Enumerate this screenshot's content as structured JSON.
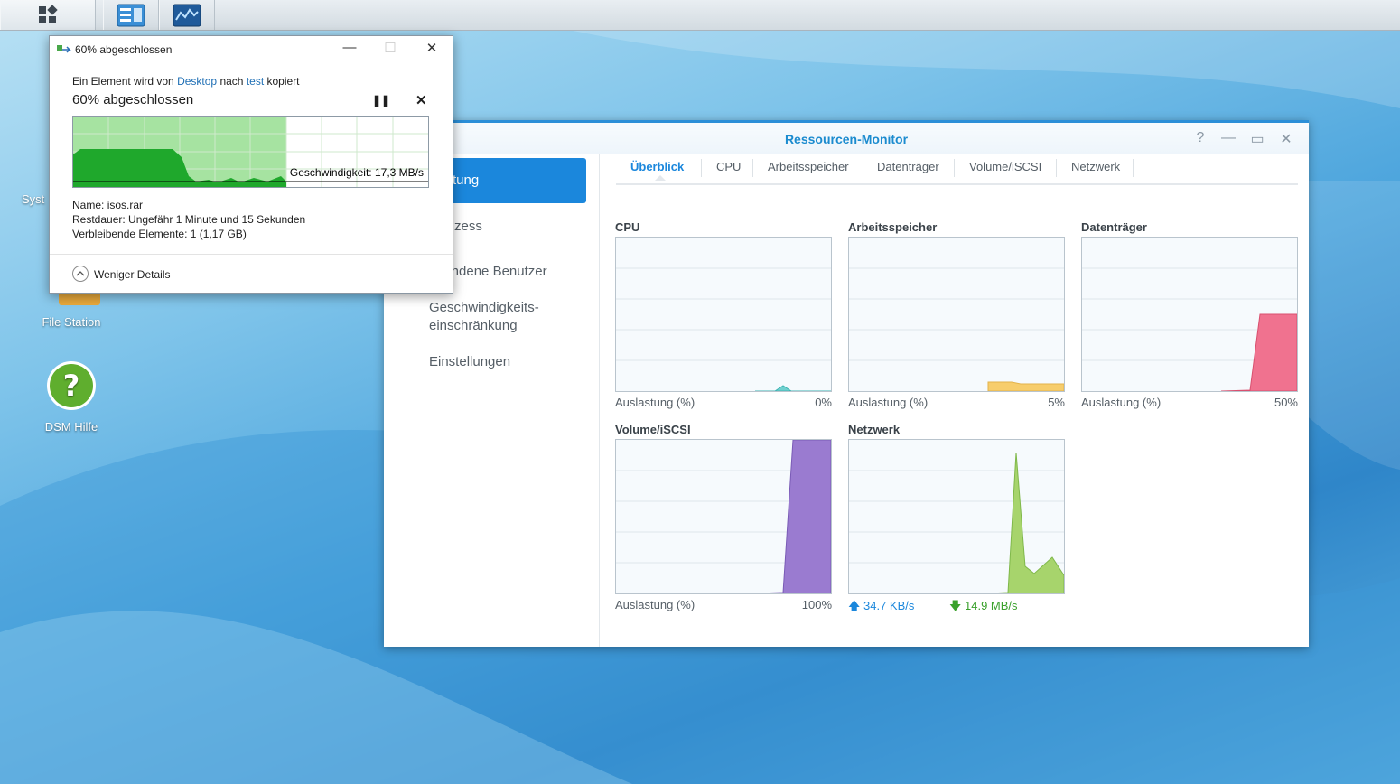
{
  "desktop": {
    "icons": [
      {
        "label": "Syst",
        "icon": "system-icon"
      },
      {
        "label": "File Station",
        "icon": "folder-search-icon"
      },
      {
        "label": "DSM Hilfe",
        "icon": "help-icon"
      }
    ]
  },
  "taskbar": {
    "items": [
      {
        "icon": "apps-grid-icon"
      },
      {
        "icon": "window-list-icon"
      },
      {
        "icon": "monitor-chart-icon"
      }
    ]
  },
  "resource_monitor": {
    "title": "Ressourcen-Monitor",
    "sidebar": {
      "items": [
        {
          "label": "tung",
          "active": true
        },
        {
          "label": "zess"
        },
        {
          "label": "bundene Benutzer"
        },
        {
          "label": "Geschwindigkeits-"
        },
        {
          "label": "einschränkung"
        },
        {
          "label": "Einstellungen"
        }
      ]
    },
    "tabs": [
      {
        "label": "Überblick",
        "active": true
      },
      {
        "label": "CPU"
      },
      {
        "label": "Arbeitsspeicher"
      },
      {
        "label": "Datenträger"
      },
      {
        "label": "Volume/iSCSI"
      },
      {
        "label": "Netzwerk"
      }
    ],
    "panels": {
      "cpu": {
        "title": "CPU",
        "label": "Auslastung (%)",
        "value": "0%",
        "level": 0.05,
        "color": "#6fd0cf"
      },
      "memory": {
        "title": "Arbeitsspeicher",
        "label": "Auslastung (%)",
        "value": "5%",
        "level": 0.05,
        "color": "#f7cd6c"
      },
      "disk": {
        "title": "Datenträger",
        "label": "Auslastung (%)",
        "value": "50%",
        "level": 0.5,
        "color": "#f0728f"
      },
      "volume": {
        "title": "Volume/iSCSI",
        "label": "Auslastung (%)",
        "value": "100%",
        "level": 1.0,
        "color": "#9a7bd0"
      },
      "network": {
        "title": "Netzwerk",
        "up": "34.7 KB/s",
        "down": "14.9 MB/s",
        "color": "#a7d46c"
      }
    },
    "colors": {
      "accent": "#1b87dc"
    }
  },
  "copy_dialog": {
    "title": "60% abgeschlossen",
    "line_prefix": "Ein Element wird von",
    "source": "Desktop",
    "line_mid": "nach",
    "target": "test",
    "line_suffix": "kopiert",
    "heading": "60% abgeschlossen",
    "progress": 0.6,
    "speed": "Geschwindigkeit: 17,3 MB/s",
    "name_label": "Name:",
    "name_value": "isos.rar",
    "remaining_label": "Restdauer:",
    "remaining_value": "Ungefähr 1 Minute und 15 Sekunden",
    "items_label": "Verbleibende Elemente:",
    "items_value": "1 (1,17 GB)",
    "less_details": "Weniger Details"
  }
}
